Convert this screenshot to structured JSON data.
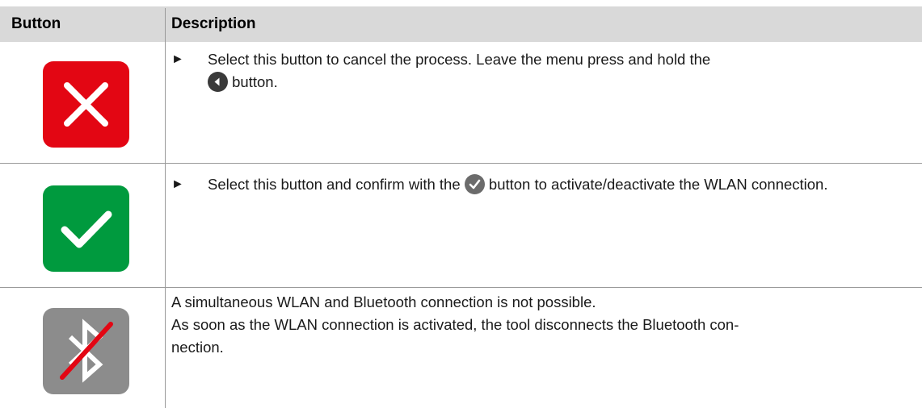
{
  "header": {
    "col_button": "Button",
    "col_description": "Description"
  },
  "rows": [
    {
      "icon": "close-icon",
      "color": "#e30613",
      "bullet": "►",
      "text_before": "Select this button to cancel the process. Leave the menu press and hold the",
      "inline_icon": "back-arrow-circle-icon",
      "text_after": "button."
    },
    {
      "icon": "checkmark-icon",
      "color": "#009a3e",
      "bullet": "►",
      "text_before": "Select this button and confirm with the",
      "inline_icon": "checkmark-circle-icon",
      "text_after": "button to activate/deactivate the WLAN connection."
    },
    {
      "icon": "bluetooth-off-icon",
      "color": "#8c8c8c",
      "strike_color": "#e30613",
      "line1": "A simultaneous WLAN and Bluetooth connection is not possible.",
      "line2": "As soon as the WLAN connection is activated, the tool disconnects the Bluetooth con-",
      "line3": "nection."
    }
  ]
}
